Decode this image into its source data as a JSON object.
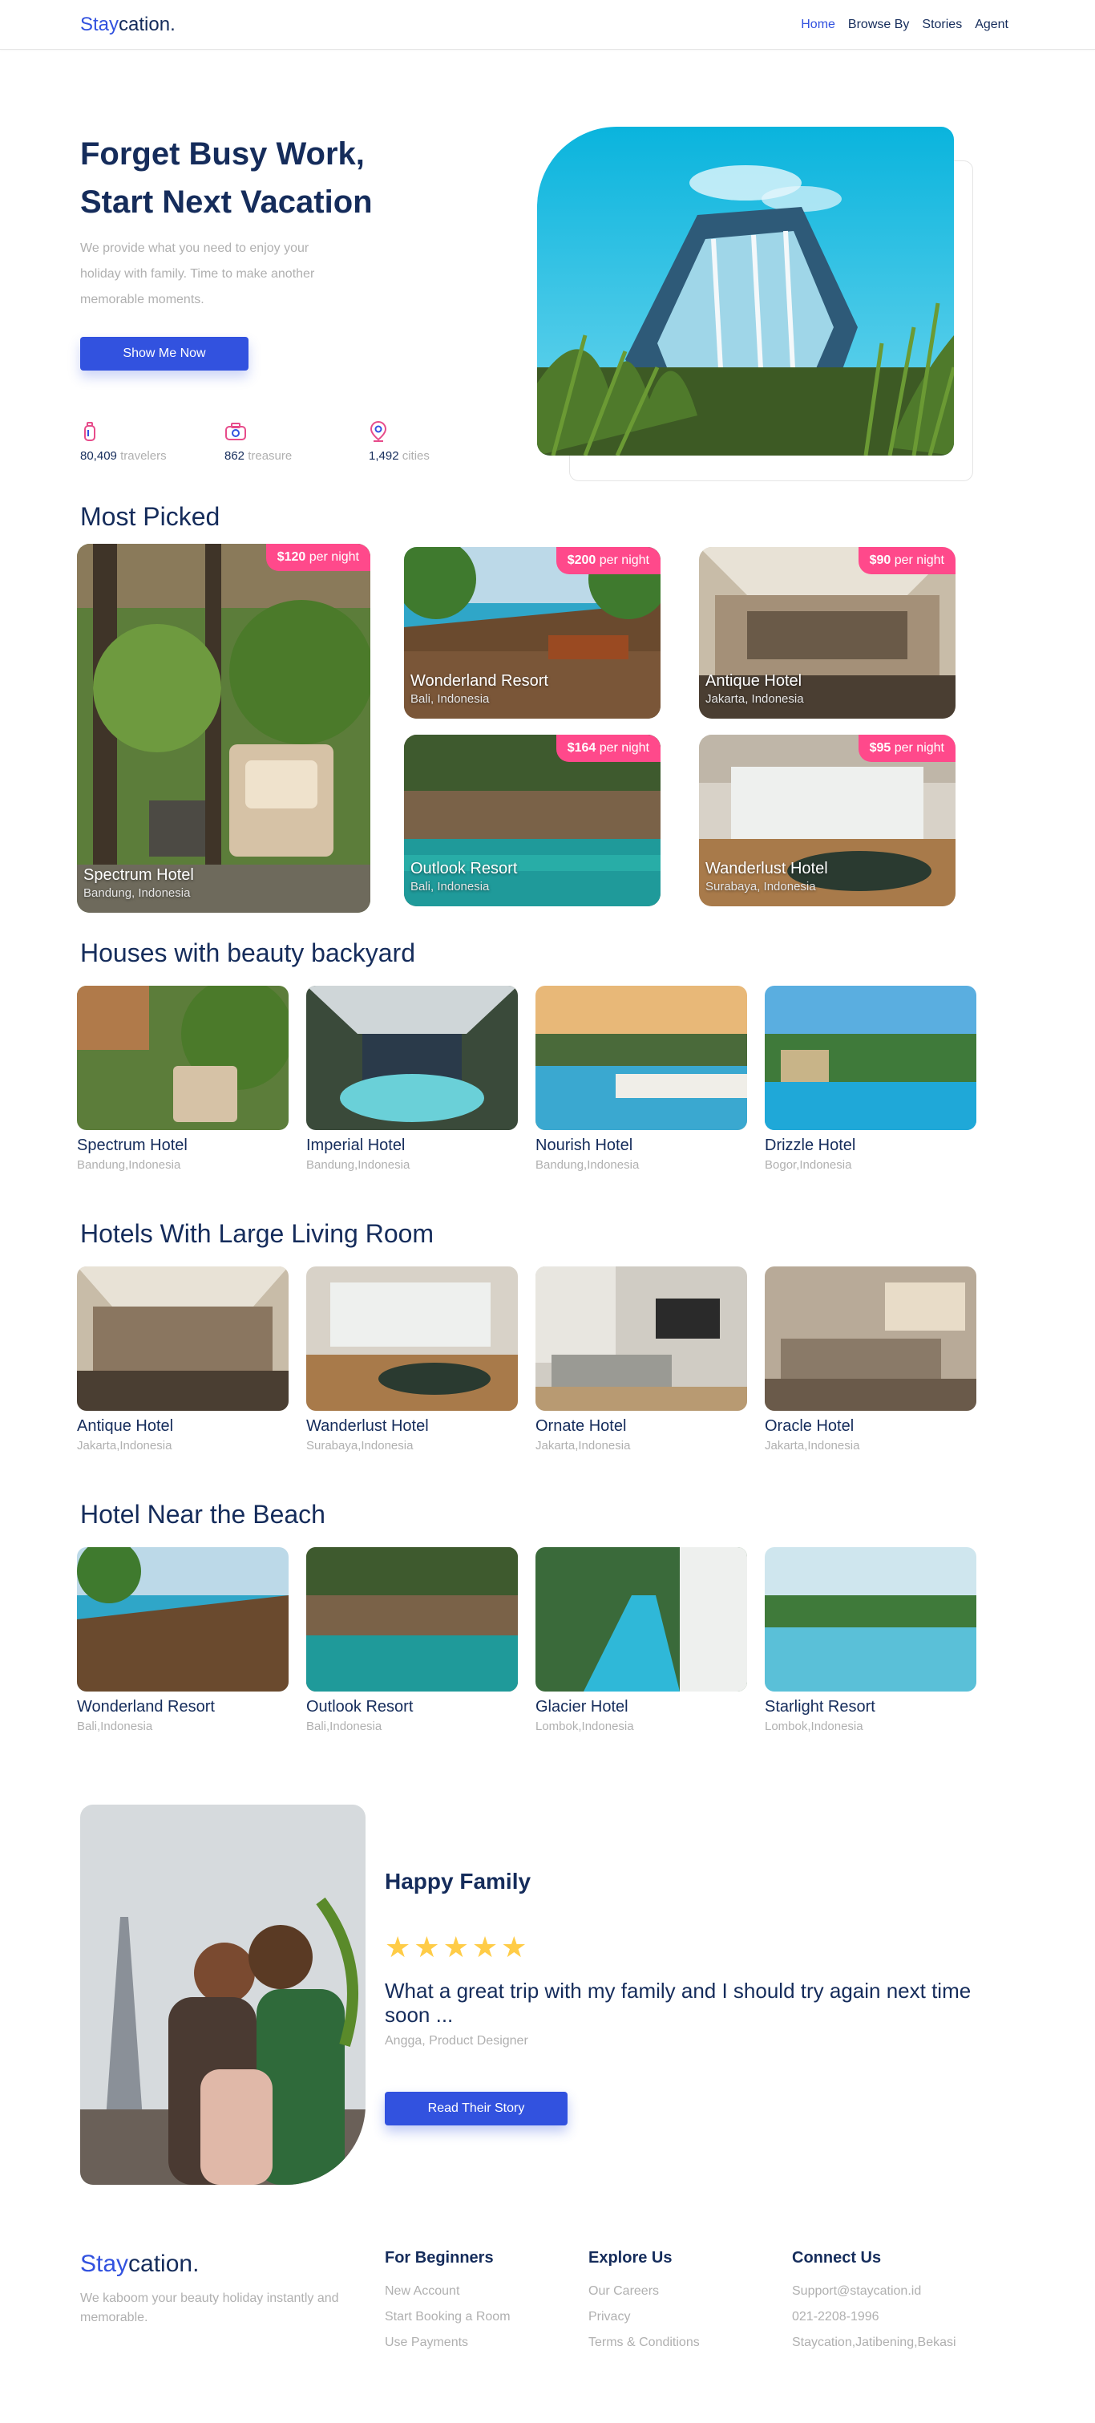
{
  "brand": {
    "accent": "Stay",
    "rest": "cation."
  },
  "nav": [
    {
      "label": "Home",
      "active": true
    },
    {
      "label": "Browse By",
      "active": false
    },
    {
      "label": "Stories",
      "active": false
    },
    {
      "label": "Agent",
      "active": false
    }
  ],
  "hero": {
    "title_line1": "Forget Busy Work,",
    "title_line2": "Start Next Vacation",
    "description": "We provide what you need to enjoy your holiday with family. Time to make another memorable moments.",
    "button_label": "Show Me Now",
    "stats": [
      {
        "number": "80,409",
        "unit": "travelers",
        "icon": "traveler-icon"
      },
      {
        "number": "862",
        "unit": "treasure",
        "icon": "camera-icon"
      },
      {
        "number": "1,492",
        "unit": "cities",
        "icon": "location-icon"
      }
    ]
  },
  "most_picked": {
    "title": "Most Picked",
    "items": [
      {
        "price": "$120",
        "per": "per night",
        "name": "Spectrum Hotel",
        "location": "Bandung, Indonesia"
      },
      {
        "price": "$200",
        "per": "per night",
        "name": "Wonderland Resort",
        "location": "Bali, Indonesia"
      },
      {
        "price": "$90",
        "per": "per night",
        "name": "Antique Hotel",
        "location": "Jakarta, Indonesia"
      },
      {
        "price": "$164",
        "per": "per night",
        "name": "Outlook Resort",
        "location": "Bali, Indonesia"
      },
      {
        "price": "$95",
        "per": "per night",
        "name": "Wanderlust Hotel",
        "location": "Surabaya, Indonesia"
      }
    ]
  },
  "categories": [
    {
      "title": "Houses with beauty backyard",
      "items": [
        {
          "name": "Spectrum Hotel",
          "location": "Bandung,Indonesia"
        },
        {
          "name": "Imperial Hotel",
          "location": "Bandung,Indonesia"
        },
        {
          "name": "Nourish Hotel",
          "location": "Bandung,Indonesia"
        },
        {
          "name": "Drizzle Hotel",
          "location": "Bogor,Indonesia"
        }
      ]
    },
    {
      "title": "Hotels With Large Living Room",
      "items": [
        {
          "name": "Antique Hotel",
          "location": "Jakarta,Indonesia"
        },
        {
          "name": "Wanderlust Hotel",
          "location": "Surabaya,Indonesia"
        },
        {
          "name": "Ornate Hotel",
          "location": "Jakarta,Indonesia"
        },
        {
          "name": "Oracle Hotel",
          "location": "Jakarta,Indonesia"
        }
      ]
    },
    {
      "title": "Hotel Near the Beach",
      "items": [
        {
          "name": "Wonderland Resort",
          "location": "Bali,Indonesia"
        },
        {
          "name": "Outlook Resort",
          "location": "Bali,Indonesia"
        },
        {
          "name": "Glacier Hotel",
          "location": "Lombok,Indonesia"
        },
        {
          "name": "Starlight Resort",
          "location": "Lombok,Indonesia"
        }
      ]
    }
  ],
  "testimonial": {
    "title": "Happy Family",
    "rating": 5,
    "quote": "What a great trip with my family and I should try again next time soon ...",
    "author": "Angga, Product Designer",
    "button_label": "Read Their Story"
  },
  "footer": {
    "tagline": "We kaboom your beauty holiday instantly and memorable.",
    "columns": [
      {
        "title": "For Beginners",
        "links": [
          "New Account",
          "Start Booking a Room",
          "Use Payments"
        ]
      },
      {
        "title": "Explore Us",
        "links": [
          "Our Careers",
          "Privacy",
          "Terms & Conditions"
        ]
      },
      {
        "title": "Connect Us",
        "links": [
          "Support@staycation.id",
          "021-2208-1996",
          "Staycation,Jatibening,Bekasi"
        ]
      }
    ]
  },
  "colors": {
    "primary": "#3252df",
    "dark": "#152c5b",
    "muted": "#b0b0b0",
    "price_tag": "#ff498b",
    "star": "#ffcc47"
  }
}
